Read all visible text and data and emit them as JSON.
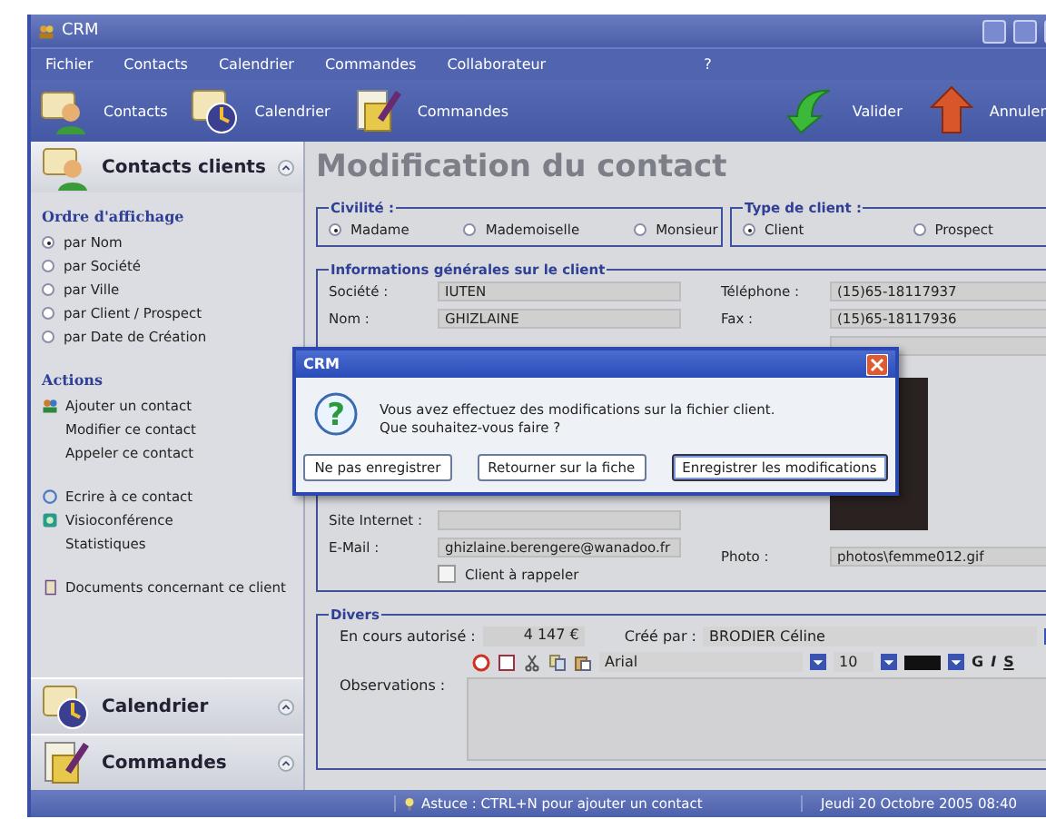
{
  "window": {
    "title": "CRM"
  },
  "menu": [
    "Fichier",
    "Contacts",
    "Calendrier",
    "Commandes",
    "Collaborateur",
    "?"
  ],
  "toolbar": {
    "left": [
      {
        "label": "Contacts"
      },
      {
        "label": "Calendrier"
      },
      {
        "label": "Commandes"
      }
    ],
    "right": [
      {
        "label": "Valider"
      },
      {
        "label": "Annuler"
      }
    ]
  },
  "sidebar": {
    "header": "Contacts clients",
    "order_title": "Ordre d'affichage",
    "order_options": [
      {
        "label": "par Nom",
        "selected": true
      },
      {
        "label": "par Société",
        "selected": false
      },
      {
        "label": "par Ville",
        "selected": false
      },
      {
        "label": "par Client / Prospect",
        "selected": false
      },
      {
        "label": "par Date de Création",
        "selected": false
      }
    ],
    "actions_title": "Actions",
    "actions": [
      "Ajouter un contact",
      "Modifier ce contact",
      "Appeler ce contact",
      "Ecrire à ce contact",
      "Visioconférence",
      "Statistiques",
      "Documents concernant ce client"
    ],
    "sections": [
      "Calendrier",
      "Commandes"
    ]
  },
  "form": {
    "title": "Modification du contact",
    "civilite": {
      "legend": "Civilité :",
      "options": [
        {
          "label": "Madame",
          "selected": true
        },
        {
          "label": "Mademoiselle",
          "selected": false
        },
        {
          "label": "Monsieur",
          "selected": false
        }
      ]
    },
    "type_client": {
      "legend": "Type de client :",
      "options": [
        {
          "label": "Client",
          "selected": true
        },
        {
          "label": "Prospect",
          "selected": false
        }
      ]
    },
    "general": {
      "legend": "Informations générales sur le client",
      "left_top": [
        {
          "label": "Société :",
          "value": "IUTEN"
        },
        {
          "label": "Nom :",
          "value": "GHIZLAINE"
        }
      ],
      "left_bottom": [
        {
          "label": "Site Internet :"
        },
        {
          "label": "E-Mail :",
          "value": "ghizlaine.berengere@wanadoo.fr"
        }
      ],
      "callback": {
        "label": "Client à rappeler",
        "checked": false
      },
      "right_top": [
        {
          "label": "Téléphone :",
          "value": "(15)65-18117937"
        },
        {
          "label": "Fax :",
          "value": "(15)65-18117936"
        }
      ],
      "photo": {
        "label": "Photo :",
        "value": "photos\\femme012.gif"
      }
    },
    "divers": {
      "legend": "Divers",
      "limit_label": "En cours autorisé :",
      "limit_value": "4 147 €",
      "creator_label": "Créé par :",
      "creator_value": "BRODIER Céline",
      "font": "Arial",
      "size": "10",
      "bold": "G",
      "italic": "I",
      "strike": "S",
      "notes_label": "Observations :"
    }
  },
  "dialog": {
    "title": "CRM",
    "icon_text": "?",
    "lines": [
      "Vous avez effectuez des modifications sur la fichier client.",
      "Que souhaitez-vous faire ?"
    ],
    "buttons": [
      {
        "label": "Ne pas enregistrer",
        "selected": false
      },
      {
        "label": "Retourner sur la fiche",
        "selected": false
      },
      {
        "label": "Enregistrer les modifications",
        "selected": true
      }
    ]
  },
  "status_bar": {
    "tip": "Astuce : CTRL+N pour ajouter un contact",
    "date": "Jeudi 20 Octobre 2005 08:40"
  }
}
